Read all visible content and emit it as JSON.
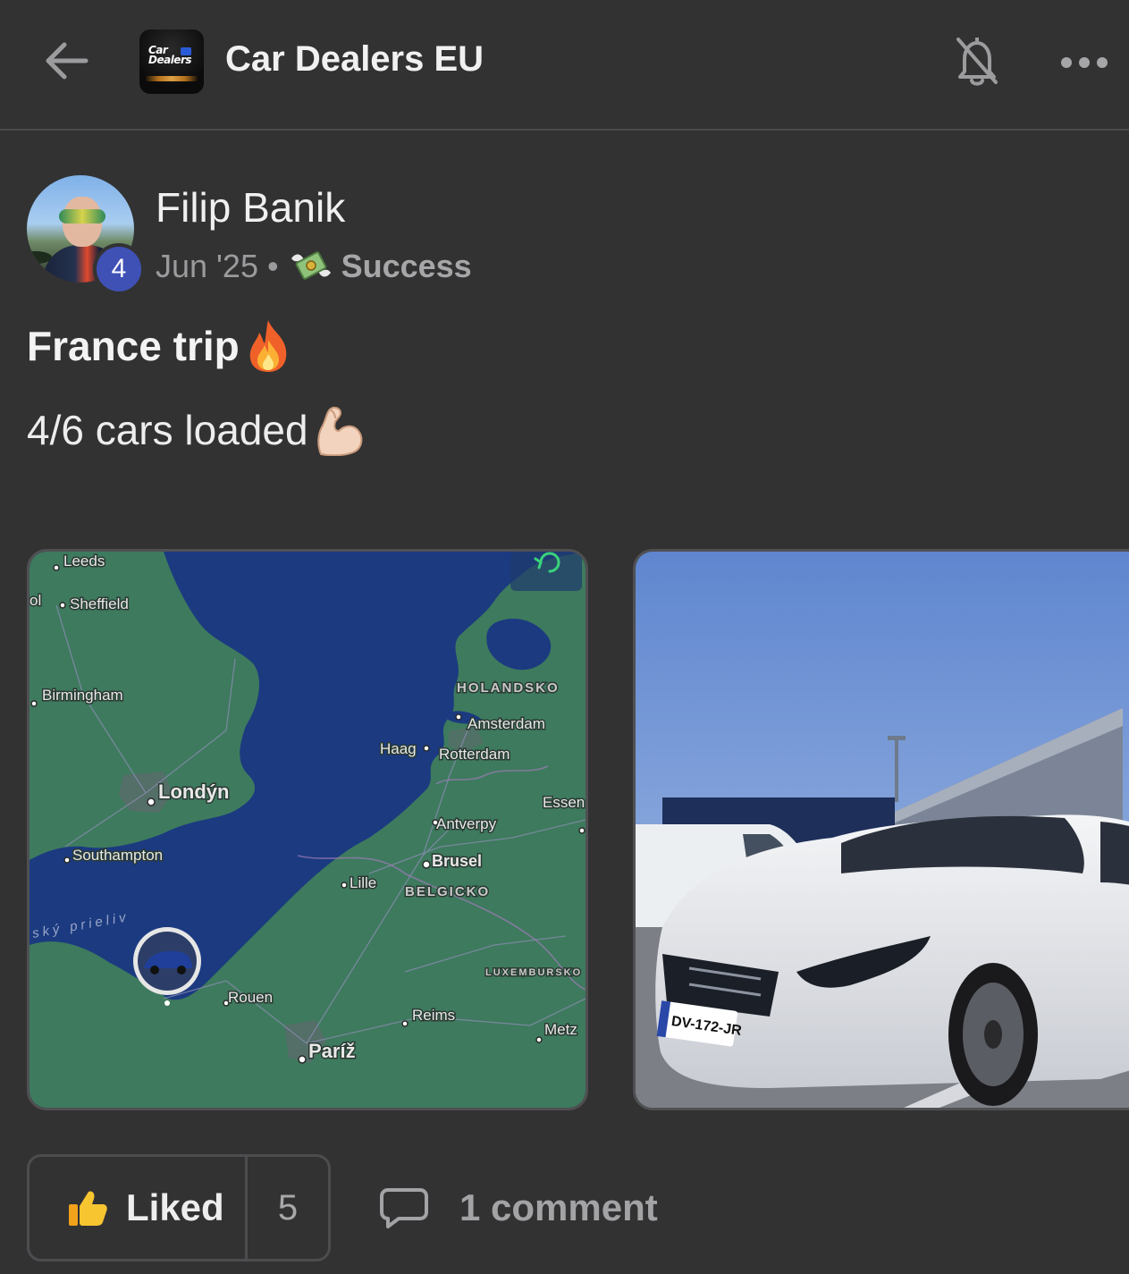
{
  "header": {
    "title": "Car Dealers EU",
    "logo_text": "Car Dealers",
    "back_icon": "arrow-left-icon",
    "notification_icon": "bell-off-icon",
    "more_icon": "more-horizontal-icon"
  },
  "post": {
    "author": {
      "name": "Filip Banik",
      "level": "4"
    },
    "date": "Jun '25",
    "separator": "•",
    "category_icon": "money-with-wings-icon",
    "category": "Success",
    "title": "France trip",
    "title_emoji": "🔥",
    "body": "4/6 cars loaded",
    "body_emoji": "💪🏻"
  },
  "media": {
    "map": {
      "labels": {
        "leeds": "Leeds",
        "ol": "ol",
        "sheffield": "Sheffield",
        "birmingham": "Birmingham",
        "london": "Londýn",
        "southampton": "Southampton",
        "channel": "ský prieliv",
        "holandsko": "HOLANDSKO",
        "amsterdam": "Amsterdam",
        "haag": "Haag",
        "rotterdam": "Rotterdam",
        "essen": "Essen",
        "antverpy": "Antverpy",
        "brusel": "Brusel",
        "belgicko": "BELGICKO",
        "lille": "Lille",
        "luxembursko": "LUXEMBURSKO",
        "rouen": "Rouen",
        "reims": "Reims",
        "metz": "Metz",
        "pariz": "Paríž"
      }
    },
    "car_photo": {
      "plate": "DV-172-JR"
    }
  },
  "actions": {
    "like_label": "Liked",
    "like_count": "5",
    "comment_label": "1 comment"
  },
  "colors": {
    "background": "#323233",
    "level_badge": "#3f51b5",
    "map_land": "#3e7a5e",
    "map_water": "#1b3a80"
  }
}
